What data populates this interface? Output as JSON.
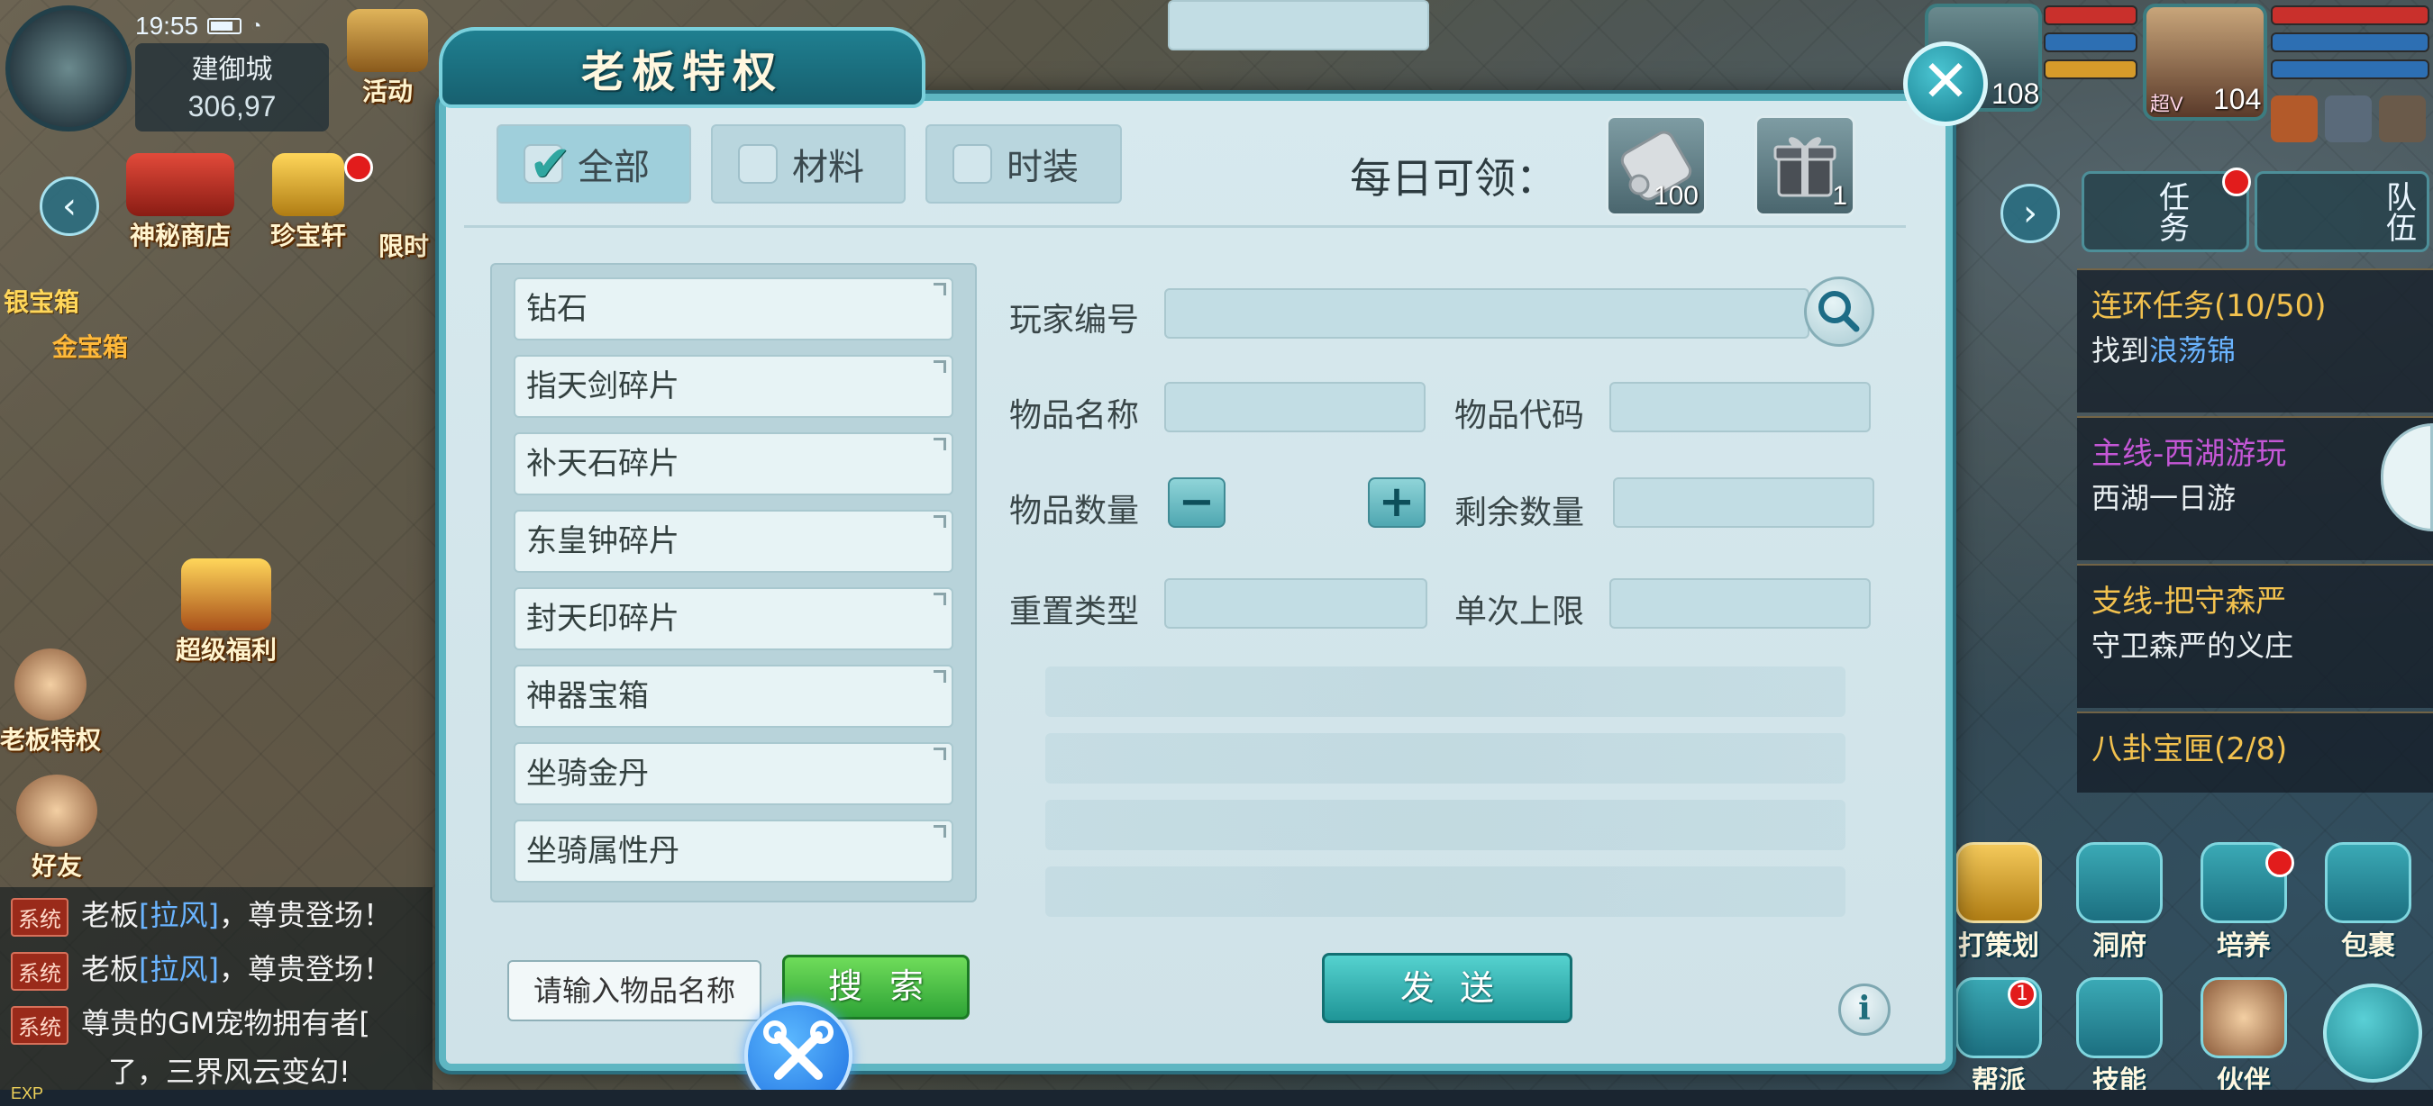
{
  "hud": {
    "time": "19:55",
    "city": "建御城",
    "coords": "306,97",
    "left_icons": [
      {
        "label": "活动"
      },
      {
        "label": "神秘商店"
      },
      {
        "label": "珍宝轩"
      },
      {
        "label": "限时"
      },
      {
        "label": "超级福利"
      },
      {
        "label": "老板特权"
      },
      {
        "label": "好友"
      }
    ],
    "silver_box": "银宝箱",
    "gold_box": "金宝箱",
    "player_levels": {
      "pet": "108",
      "player": "104"
    },
    "vip_label": "超V",
    "task_button": "任务",
    "team_button": "队伍",
    "exp_label": "EXP"
  },
  "quests": [
    {
      "title": "连环任务(10/50)",
      "title_color": "#f2c14e",
      "desc_prefix": "找到",
      "desc_link": "浪荡锦"
    },
    {
      "title": "主线-西湖游玩",
      "title_color": "#c457d6",
      "desc": "西湖一日游"
    },
    {
      "title": "支线-把守森严",
      "title_color": "#f2c14e",
      "desc": "守卫森严的义庄"
    },
    {
      "title": "八卦宝匣(2/8)",
      "title_color": "#f2c14e"
    }
  ],
  "right_buttons": [
    {
      "label": "打策划"
    },
    {
      "label": "洞府"
    },
    {
      "label": "培养"
    },
    {
      "label": "包裹"
    },
    {
      "label": "帮派",
      "badge": "1"
    },
    {
      "label": "技能"
    },
    {
      "label": "伙伴"
    }
  ],
  "chat": [
    {
      "tag": "系统",
      "before": "老板",
      "name": "[拉风]",
      "after": "，尊贵登场！"
    },
    {
      "tag": "系统",
      "before": "老板",
      "name": "[拉风]",
      "after": "，尊贵登场！"
    },
    {
      "tag": "系统",
      "before": "尊贵的GM宠物拥有者[",
      "name": "",
      "after": ""
    },
    {
      "tag": "",
      "before": "了，三界风云变幻!",
      "name": "",
      "after": ""
    }
  ],
  "modal": {
    "title": "老板特权",
    "close": "✕",
    "tabs": [
      {
        "label": "全部",
        "checked": true
      },
      {
        "label": "材料",
        "checked": false
      },
      {
        "label": "时装",
        "checked": false
      }
    ],
    "daily_label": "每日可领：",
    "daily_items": [
      {
        "icon": "scroll-icon",
        "count": "100"
      },
      {
        "icon": "gift-box-icon",
        "count": "1"
      }
    ],
    "item_list": [
      "钻石",
      "指天剑碎片",
      "补天石碎片",
      "东皇钟碎片",
      "封天印碎片",
      "神器宝箱",
      "坐骑金丹",
      "坐骑属性丹"
    ],
    "form": {
      "player_id_label": "玩家编号",
      "item_name_label": "物品名称",
      "item_code_label": "物品代码",
      "quantity_label": "物品数量",
      "remaining_label": "剩余数量",
      "reset_type_label": "重置类型",
      "single_limit_label": "单次上限"
    },
    "name_input_placeholder": "请输入物品名称",
    "search_button": "搜索",
    "send_button": "发送",
    "info_button": "i"
  }
}
